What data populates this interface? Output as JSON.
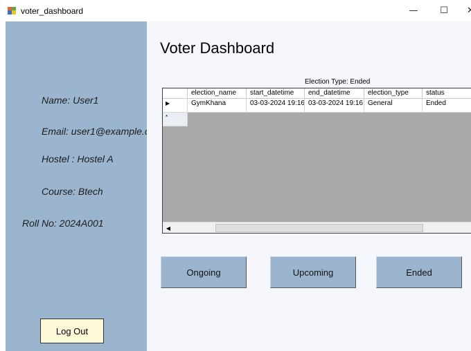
{
  "window": {
    "title": "voter_dashboard",
    "min_glyph": "—",
    "max_glyph": "☐",
    "close_glyph": "✕",
    "icon": "app-icon"
  },
  "sidebar": {
    "name": "Name: User1",
    "email": "Email: user1@example.c",
    "hostel": "Hostel : Hostel A",
    "course": "Course: Btech",
    "roll": "Roll No: 2024A001",
    "logout_label": "Log Out",
    "bg_color": "#9bb5cf"
  },
  "main": {
    "title": "Voter Dashboard",
    "grid_caption": "Election Type: Ended"
  },
  "grid": {
    "columns": [
      "election_name",
      "start_datetime",
      "end_datetime",
      "election_type",
      "status"
    ],
    "rows": [
      {
        "marker": "▶",
        "cells": [
          "GymKhana",
          "03-03-2024 19:16",
          "03-03-2024 19:16",
          "General",
          "Ended"
        ]
      }
    ],
    "new_row_marker": "*",
    "scroll_left_glyph": "◀"
  },
  "buttons": {
    "ongoing": "Ongoing",
    "upcoming": "Upcoming",
    "ended": "Ended"
  }
}
